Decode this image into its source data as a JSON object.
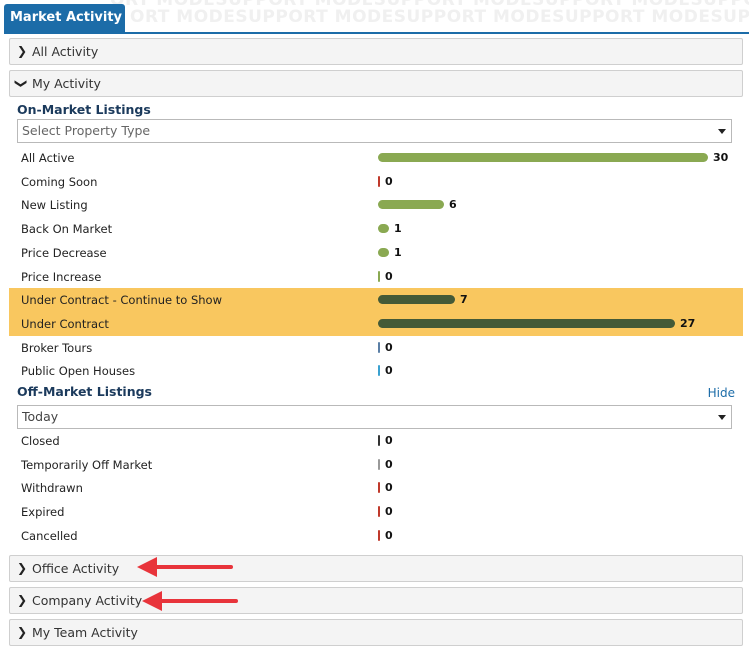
{
  "watermark": "ORT MODESUPPORT MODESUPPORT MODESUPPORT MODESUPPORT MODESUPPORT MODESUPPORT",
  "tab_title": "Market Activity",
  "sections": {
    "all_activity": "All Activity",
    "my_activity": "My Activity",
    "office_activity": "Office Activity",
    "company_activity": "Company Activity",
    "my_team_activity": "My Team Activity"
  },
  "on_market": {
    "title": "On-Market Listings",
    "select_placeholder": "Select Property Type",
    "max": 30,
    "rows": [
      {
        "label": "All Active",
        "value": 30,
        "color": "#8aa952",
        "highlight": false
      },
      {
        "label": "Coming Soon",
        "value": 0,
        "color": "#c0392b",
        "highlight": false
      },
      {
        "label": "New Listing",
        "value": 6,
        "color": "#8aa952",
        "highlight": false
      },
      {
        "label": "Back On Market",
        "value": 1,
        "color": "#8aa952",
        "highlight": false
      },
      {
        "label": "Price Decrease",
        "value": 1,
        "color": "#8aa952",
        "highlight": false
      },
      {
        "label": "Price Increase",
        "value": 0,
        "color": "#8aa952",
        "highlight": false
      },
      {
        "label": "Under Contract - Continue to Show",
        "value": 7,
        "color": "#445a37",
        "highlight": true
      },
      {
        "label": "Under Contract",
        "value": 27,
        "color": "#445a37",
        "highlight": true
      },
      {
        "label": "Broker Tours",
        "value": 0,
        "color": "#5b7fa6",
        "highlight": false
      },
      {
        "label": "Public Open Houses",
        "value": 0,
        "color": "#3aa1d0",
        "highlight": false
      }
    ]
  },
  "off_market": {
    "title": "Off-Market Listings",
    "hide_label": "Hide",
    "select_value": "Today",
    "rows": [
      {
        "label": "Closed",
        "value": 0,
        "color": "#333333"
      },
      {
        "label": "Temporarily Off Market",
        "value": 0,
        "color": "#999999"
      },
      {
        "label": "Withdrawn",
        "value": 0,
        "color": "#c0392b"
      },
      {
        "label": "Expired",
        "value": 0,
        "color": "#c0392b"
      },
      {
        "label": "Cancelled",
        "value": 0,
        "color": "#c0392b"
      }
    ]
  },
  "colors": {
    "accent": "#1c6ca8",
    "highlight_row": "#f9c75f",
    "annotation_arrow": "#e8343b"
  }
}
